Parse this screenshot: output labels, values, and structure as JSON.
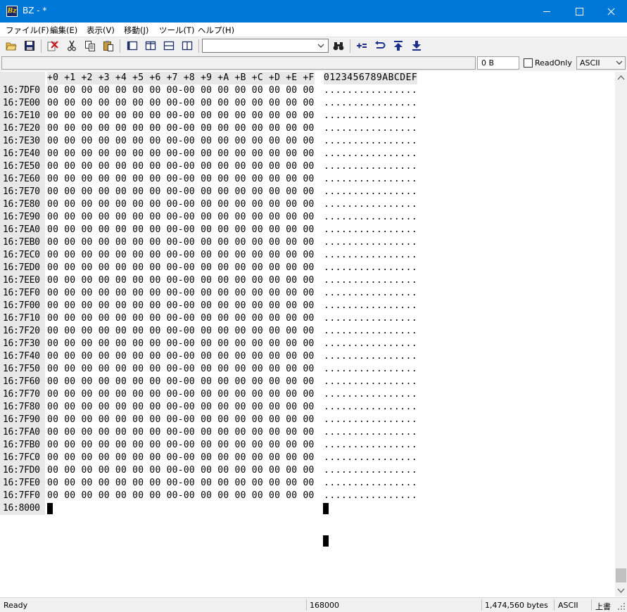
{
  "window": {
    "title": "BZ - *",
    "app_icon_text": "Bz"
  },
  "menu": [
    {
      "label": "ファイル(F)"
    },
    {
      "label": "編集(E)"
    },
    {
      "label": "表示(V)"
    },
    {
      "label": "移動(J)"
    },
    {
      "label": "ツール(T)"
    },
    {
      "label": "ヘルプ(H)"
    }
  ],
  "toolbar": {
    "search_combo_value": "",
    "icons": [
      "open-folder-icon",
      "save-icon",
      "delete-icon",
      "cut-icon",
      "copy-icon",
      "paste-icon",
      "view-single-icon",
      "view-split-vertical-icon",
      "view-split-horizontal-icon",
      "view-compare-icon",
      "find-binoculars-icon",
      "add-equals-icon",
      "jump-back-icon",
      "jump-top-icon",
      "jump-bottom-icon"
    ]
  },
  "addrbar": {
    "address_value": "",
    "size_value": "0 B",
    "readonly_label": "ReadOnly",
    "readonly_checked": false,
    "encoding_value": "ASCII"
  },
  "hexview": {
    "header_bytes": "+0 +1 +2 +3 +4 +5 +6 +7 +8 +9 +A +B +C +D +E +F",
    "header_ascii": "0123456789ABCDEF",
    "row_bytes": "00 00 00 00 00 00 00 00-00 00 00 00 00 00 00 00",
    "row_ascii": "................",
    "rows": [
      "16:7DF0",
      "16:7E00",
      "16:7E10",
      "16:7E20",
      "16:7E30",
      "16:7E40",
      "16:7E50",
      "16:7E60",
      "16:7E70",
      "16:7E80",
      "16:7E90",
      "16:7EA0",
      "16:7EB0",
      "16:7EC0",
      "16:7ED0",
      "16:7EE0",
      "16:7EF0",
      "16:7F00",
      "16:7F10",
      "16:7F20",
      "16:7F30",
      "16:7F40",
      "16:7F50",
      "16:7F60",
      "16:7F70",
      "16:7F80",
      "16:7F90",
      "16:7FA0",
      "16:7FB0",
      "16:7FC0",
      "16:7FD0",
      "16:7FE0",
      "16:7FF0"
    ],
    "last_row_address": "16:8000"
  },
  "statusbar": {
    "state": "Ready",
    "offset": "168000",
    "size": "1,474,560 bytes",
    "encoding": "ASCII",
    "mode": "上書"
  }
}
